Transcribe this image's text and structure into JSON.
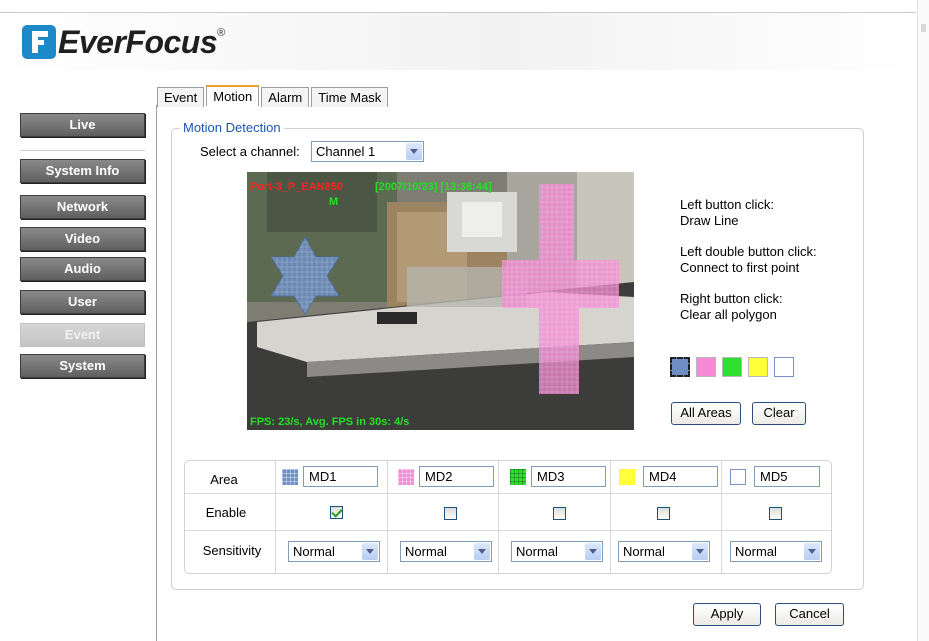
{
  "brand": {
    "name": "EverFocus",
    "reg": "®"
  },
  "sidebar": {
    "items": [
      {
        "label": "Live"
      },
      {
        "label": "System Info"
      },
      {
        "label": "Network"
      },
      {
        "label": "Video"
      },
      {
        "label": "Audio"
      },
      {
        "label": "User"
      },
      {
        "label": "Event"
      },
      {
        "label": "System"
      }
    ],
    "active": "Event"
  },
  "tabs": [
    {
      "label": "Event"
    },
    {
      "label": "Motion"
    },
    {
      "label": "Alarm"
    },
    {
      "label": "Time Mask"
    }
  ],
  "active_tab": "Motion",
  "motion": {
    "legend": "Motion Detection",
    "channel_label": "Select a channel:",
    "channel_value": "Channel 1",
    "video": {
      "camera_name": "Port-3_P_EAN850",
      "timestamp": "[2007/10/23] [13:36:44]",
      "motion_flag": "M",
      "fps_text": "FPS: 23/s, Avg. FPS in 30s: 4/s"
    },
    "help": [
      {
        "title": "Left button click:",
        "desc": "Draw Line"
      },
      {
        "title": "Left double button click:",
        "desc": "Connect to first point"
      },
      {
        "title": "Right button click:",
        "desc": "Clear all polygon"
      }
    ],
    "swatch_colors": [
      "#6f8fc4",
      "#f58ad6",
      "#2ee02e",
      "#ffff3a",
      "#ffffff"
    ],
    "all_areas_label": "All Areas",
    "clear_label": "Clear",
    "table": {
      "area_label": "Area",
      "enable_label": "Enable",
      "sensitivity_label": "Sensitivity",
      "areas": [
        {
          "name": "MD1",
          "color": "#6f8fc4",
          "enabled": true,
          "sensitivity": "Normal"
        },
        {
          "name": "MD2",
          "color": "#f58ad6",
          "enabled": false,
          "sensitivity": "Normal"
        },
        {
          "name": "MD3",
          "color": "#2ee02e",
          "enabled": false,
          "sensitivity": "Normal"
        },
        {
          "name": "MD4",
          "color": "#ffff3a",
          "enabled": false,
          "sensitivity": "Normal"
        },
        {
          "name": "MD5",
          "color": "#ffffff",
          "enabled": false,
          "sensitivity": "Normal"
        }
      ]
    }
  },
  "footer": {
    "apply_label": "Apply",
    "cancel_label": "Cancel"
  }
}
